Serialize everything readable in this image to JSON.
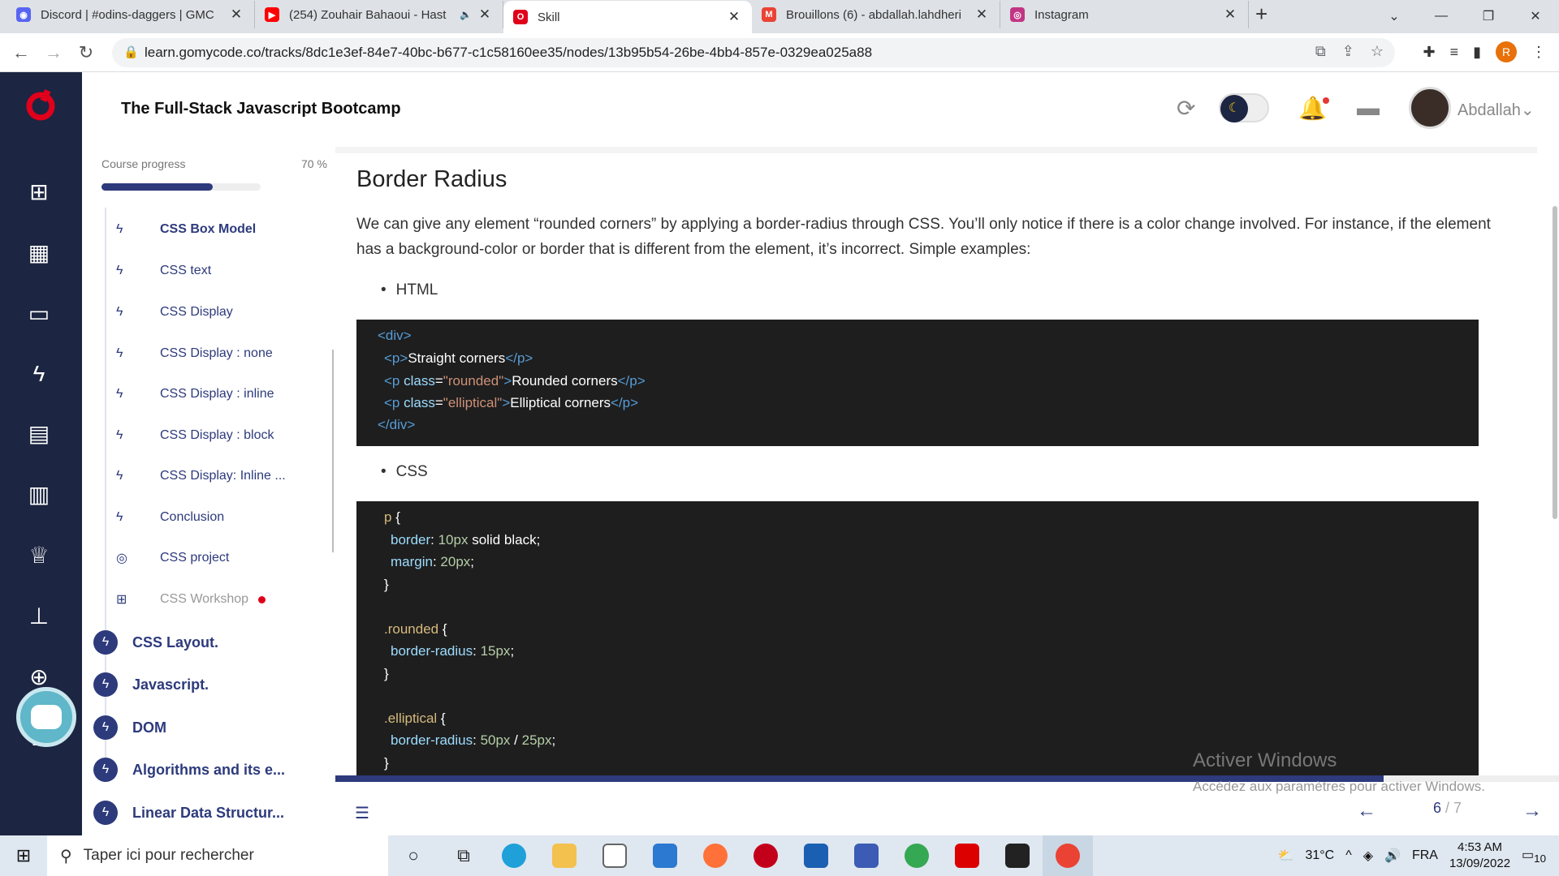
{
  "browser": {
    "tabs": [
      {
        "title": "Discord | #odins-daggers | GMC",
        "color": "#5865f2",
        "icon": "discord-icon"
      },
      {
        "title": "(254) Zouhair Bahaoui - Hast",
        "color": "#ff0000",
        "icon": "youtube-icon",
        "audio": true
      },
      {
        "title": "Skill",
        "color": "#e0001b",
        "icon": "gomycode-icon",
        "active": true
      },
      {
        "title": "Brouillons (6) - abdallah.lahdheri",
        "color": "#ea4335",
        "icon": "gmail-icon"
      },
      {
        "title": "Instagram",
        "color": "#c13584",
        "icon": "instagram-icon"
      }
    ],
    "url": "learn.gomycode.co/tracks/8dc1e3ef-84e7-40bc-b677-c1c58160ee35/nodes/13b95b54-26be-4bb4-857e-0329ea025a88",
    "profile_initial": "R"
  },
  "app": {
    "course_title": "The Full-Stack Javascript Bootcamp",
    "username": "Abdallah",
    "accent": "#2d3a7c",
    "nav_bg": "#1c2541"
  },
  "sidebar": {
    "progress_label": "Course progress",
    "progress_pct_text": "70 %",
    "progress": 0.7,
    "lessons": [
      {
        "label": "CSS Box Model",
        "icon": "bolt-icon",
        "current": true
      },
      {
        "label": "CSS text",
        "icon": "bolt-icon"
      },
      {
        "label": "CSS Display",
        "icon": "bolt-icon"
      },
      {
        "label": "CSS Display : none",
        "icon": "bolt-icon"
      },
      {
        "label": "CSS Display : inline",
        "icon": "bolt-icon"
      },
      {
        "label": "CSS Display : block",
        "icon": "bolt-icon"
      },
      {
        "label": "CSS Display: Inline ...",
        "icon": "bolt-icon"
      },
      {
        "label": "Conclusion",
        "icon": "bolt-icon"
      },
      {
        "label": "CSS project",
        "icon": "target-icon"
      },
      {
        "label": "CSS Workshop",
        "icon": "workshop-icon",
        "locked": true
      }
    ],
    "modules": [
      {
        "label": "CSS Layout."
      },
      {
        "label": "Javascript."
      },
      {
        "label": "DOM"
      },
      {
        "label": "Algorithms and its e..."
      },
      {
        "label": "Linear Data Structur..."
      }
    ]
  },
  "content": {
    "heading": "Border Radius",
    "paragraph": "We can give any element “rounded corners” by applying a border-radius through CSS. You’ll only notice if there is a color change involved. For instance, if the element has a background-color or border that is different from the element, it’s incorrect. Simple examples:",
    "bullet_html": "HTML",
    "bullet_css": "CSS",
    "html_code": {
      "l1": "<div>",
      "l2_open": "<p>",
      "l2_text": "Straight corners",
      "l2_close": "</p>",
      "l3_open": "<p ",
      "l3_attr": "class",
      "l3_eq": "=",
      "l3_val": "\"rounded\"",
      "l3_gt": ">",
      "l3_text": "Rounded corners",
      "l3_close": "</p>",
      "l4_open": "<p ",
      "l4_attr": "class",
      "l4_eq": "=",
      "l4_val": "\"elliptical\"",
      "l4_gt": ">",
      "l4_text": "Elliptical corners",
      "l4_close": "</p>",
      "l5": "</div>"
    },
    "css_code": {
      "r1_sel": "p",
      "r1_brace": " {",
      "r1_p1": "border",
      "r1_v1a": ": ",
      "r1_v1b": "10px",
      "r1_v1c": " solid black;",
      "r1_p2": "margin",
      "r1_v2a": ": ",
      "r1_v2b": "20px",
      "r1_v2c": ";",
      "close": "}",
      "r2_sel": ".rounded",
      "r2_brace": " {",
      "r2_p1": "border-radius",
      "r2_v1a": ": ",
      "r2_v1b": "15px",
      "r2_v1c": ";",
      "r3_sel": ".elliptical",
      "r3_brace": " {",
      "r3_p1": "border-radius",
      "r3_v1a": ": ",
      "r3_v1b": "50px",
      "r3_v1c": " / ",
      "r3_v1d": "25px",
      "r3_v1e": ";"
    }
  },
  "pager": {
    "current": "6",
    "sep_total": " / 7",
    "fraction": 0.857
  },
  "watermark": {
    "line1": "Activer Windows",
    "line2": "Accédez aux paramètres pour activer Windows."
  },
  "taskbar": {
    "search_placeholder": "Taper ici pour rechercher",
    "weather": "31°C",
    "lang": "FRA",
    "time": "4:53 AM",
    "date": "13/09/2022",
    "notifications": "10"
  }
}
